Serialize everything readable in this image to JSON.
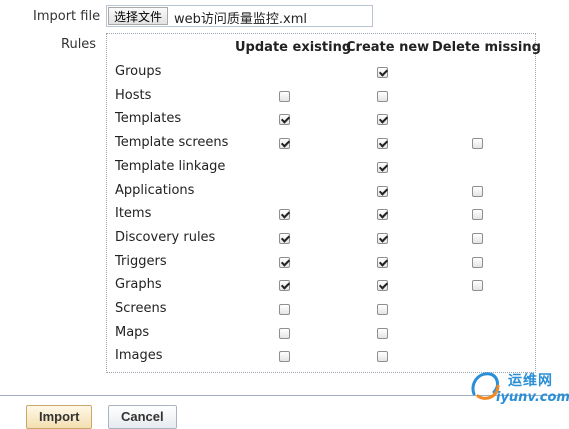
{
  "form": {
    "import_file_label": "Import file",
    "choose_file_button": "选择文件",
    "file_name": "web访问质量监控.xml",
    "rules_label": "Rules"
  },
  "columns": {
    "update_existing": "Update existing",
    "create_new": "Create new",
    "delete_missing": "Delete missing"
  },
  "rules": [
    {
      "label": "Groups",
      "update": null,
      "create": true,
      "delete": null
    },
    {
      "label": "Hosts",
      "update": false,
      "create": false,
      "delete": null
    },
    {
      "label": "Templates",
      "update": true,
      "create": true,
      "delete": null
    },
    {
      "label": "Template screens",
      "update": true,
      "create": true,
      "delete": false
    },
    {
      "label": "Template linkage",
      "update": null,
      "create": true,
      "delete": null
    },
    {
      "label": "Applications",
      "update": null,
      "create": true,
      "delete": false
    },
    {
      "label": "Items",
      "update": true,
      "create": true,
      "delete": false
    },
    {
      "label": "Discovery rules",
      "update": true,
      "create": true,
      "delete": false
    },
    {
      "label": "Triggers",
      "update": true,
      "create": true,
      "delete": false
    },
    {
      "label": "Graphs",
      "update": true,
      "create": true,
      "delete": false
    },
    {
      "label": "Screens",
      "update": false,
      "create": false,
      "delete": null
    },
    {
      "label": "Maps",
      "update": false,
      "create": false,
      "delete": null
    },
    {
      "label": "Images",
      "update": false,
      "create": false,
      "delete": null
    }
  ],
  "buttons": {
    "import": "Import",
    "cancel": "Cancel"
  },
  "watermark": {
    "cn": "运维网",
    "en": "iyunv.com"
  }
}
